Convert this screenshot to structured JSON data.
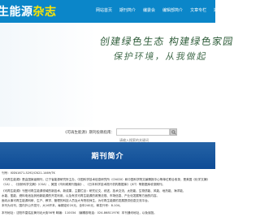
{
  "header": {
    "logo_main": "生能源",
    "logo_accent": "杂志",
    "nav": [
      "网站首页",
      "期刊简介",
      "编委会",
      "编辑部简介",
      "文章专栏",
      "期刊订阅"
    ]
  },
  "banner": {
    "slogan_line1": "创建绿色生态 构建绿色家园",
    "slogan_line2": "保护环境，从我做起"
  },
  "search": {
    "label": "《可再生能源》期刊投稿指南：",
    "placeholder": "请输入搜索的关键词"
  },
  "section": {
    "title": "期刊简介"
  },
  "intro": {
    "lines": [
      "刊号：ISSN1671-5292/CN21-1469/TK",
      "《可再生能源》是由国家级期刊，辽宁省能源研究所主办，中国科学技术信息研究所（CNCDI）和中国科学院文献情报中心等单位联合收录，是美国《化学文摘》",
      "（CA）、《剑桥科学文摘》（CSA）、美国《乌利希期刊指南》、《日本科学技术振兴机构数据库》（JST）等数据库收录期刊。",
      "《可再生能源》刊登可再生能源领域的新技术、新成果，主要栏目：研究论文、综述、技术交流、太阳能、生物质能、风能、地热能、海洋能、",
      "水能、氢能、燃料电池及其他新能源的开发利用，以及有关可再生能源的政策法规、市场信息、产业化发展等方面的内容。",
      "面向从事可再生能源科研、生产、教学、管理的科技人员及大专院校师生，为可再生能源的发展提供信息交流平台。",
      "本刊为月刊，国内外公开发行，大16开本，每期定价20元，全年240元，邮发代号：8-104。",
      "本刊地址：沈阳市皇姑区黄河北大街56号 邮编：110034 （编辑部电话：024-86811976）本刊通讯地址，以免误投。"
    ]
  },
  "colors": {
    "header_bg": "#0b86c9",
    "logo_accent": "#ffe600",
    "section_bg": "#0e4c96",
    "slogan": "#2f5d3a",
    "highlight_text": "#d62b2b"
  },
  "icons": {
    "search_button": "search-icon"
  }
}
